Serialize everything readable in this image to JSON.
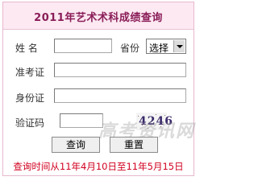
{
  "title": "2011年艺术术科成绩查询",
  "form": {
    "name_label": "姓 名",
    "province_label": "省份",
    "province_select_value": "选择",
    "exam_id_label": "准考证",
    "id_card_label": "身份证",
    "captcha_label": "验证码",
    "captcha_code": "4246"
  },
  "buttons": {
    "query": "查询",
    "reset": "重置"
  },
  "footer_note": "查询时间从11年4月10日至11年5月15日",
  "watermark": "高考资讯网",
  "colors": {
    "title": "#8a1d58",
    "title_bg": "#fce9f2",
    "note": "#d1001f",
    "border": "#e7b7cd"
  }
}
